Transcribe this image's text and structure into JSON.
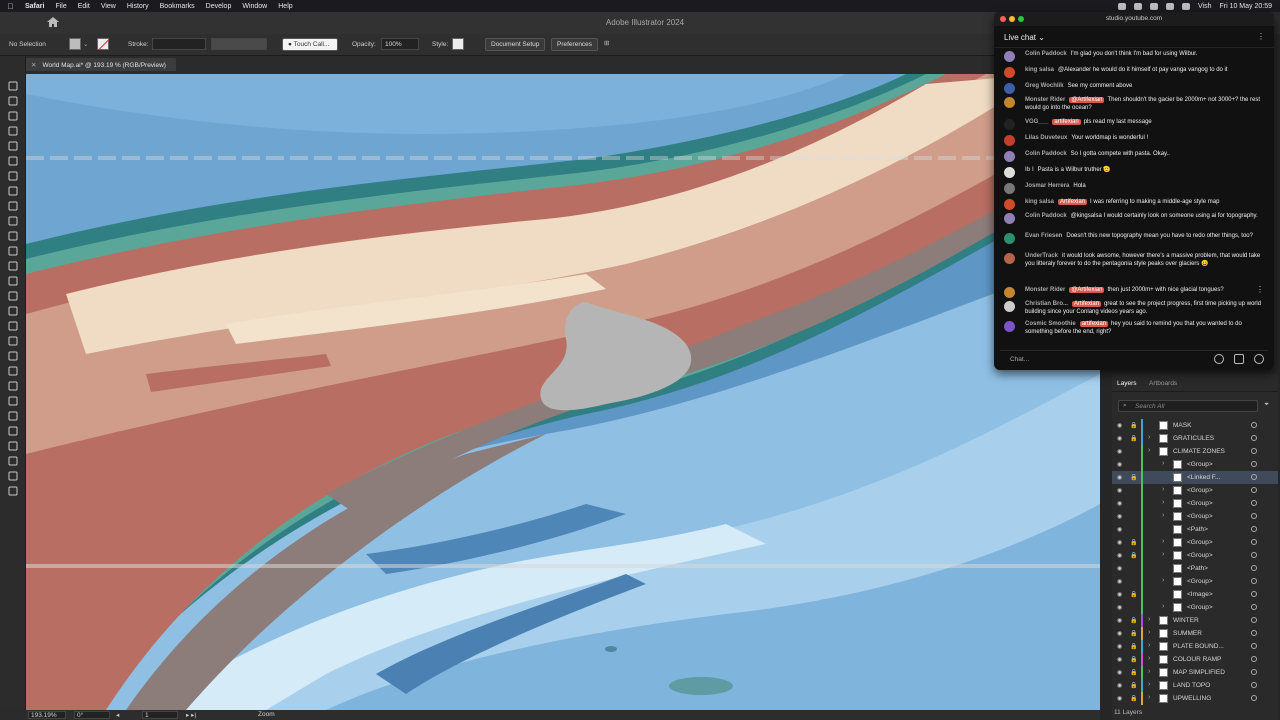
{
  "menubar": {
    "app": "Safari",
    "items": [
      "File",
      "Edit",
      "View",
      "History",
      "Bookmarks",
      "Develop",
      "Window",
      "Help"
    ],
    "user": "Vish",
    "datetime": "Fri 10 May  20:59"
  },
  "titlebar": {
    "title": "Adobe Illustrator 2024"
  },
  "controlbar": {
    "selection": "No Selection",
    "stroke_label": "Stroke:",
    "brush": "Touch Call...",
    "opacity_label": "Opacity:",
    "opacity_value": "100%",
    "style_label": "Style:",
    "document_setup": "Document Setup",
    "preferences": "Preferences"
  },
  "document_tab": {
    "name": "World Map.ai* @ 193.19 % (RGB/Preview)"
  },
  "statusbar": {
    "zoom": "193.19%",
    "rotation": "0°",
    "artboard": "1",
    "tool": "Zoom"
  },
  "chat": {
    "url": "studio.youtube.com",
    "header": "Live chat",
    "input_placeholder": "Chat...",
    "messages": [
      {
        "author": "Colin Paddock",
        "mention": "",
        "text": "I'm glad you don't think I'm bad for using Wilbur.",
        "avatar": "#8f7fb5"
      },
      {
        "author": "king salsa",
        "mention": "",
        "text": "@Alexander he would do it himself ot pay vanga vangog to do it",
        "avatar": "#d14b2b"
      },
      {
        "author": "Greg Wochlik",
        "mention": "",
        "text": "See my comment above",
        "avatar": "#3d5fa8"
      },
      {
        "author": "Monster Rider",
        "mention": "@Artifexian",
        "text": "Then shouldn't the gacier be 2000m+ not 3000+? the rest would go into the ocean?",
        "avatar": "#c4862e"
      },
      {
        "author": "VGG___",
        "mention": "artifexian",
        "text": "pls read my last message",
        "avatar": "#222222"
      },
      {
        "author": "Lilas Duveteux",
        "mention": "",
        "text": "Your worldmap is wonderful !",
        "avatar": "#c43d2e"
      },
      {
        "author": "Colin Paddock",
        "mention": "",
        "text": "So I gotta compete with pasta. Okay..",
        "avatar": "#8f7fb5"
      },
      {
        "author": "lb l",
        "mention": "",
        "text": "Pasta is a Wilbur truther 🫡",
        "avatar": "#dddddd"
      },
      {
        "author": "Josmar Herrera",
        "mention": "",
        "text": "Hola",
        "avatar": "#777777"
      },
      {
        "author": "king salsa",
        "mention": "Artifexian",
        "text": "I was referring to making a middle-age style map",
        "avatar": "#d14b2b"
      },
      {
        "author": "Colin Paddock",
        "mention": "",
        "text": "@kingsalsa I would certainly look on someone using ai for topography.",
        "avatar": "#8f7fb5"
      },
      {
        "author": "Evan Friesen",
        "mention": "",
        "text": "Doesn't this new topography mean you have to redo other things, too?",
        "avatar": "#2e8f6e"
      },
      {
        "author": "UnderTrack",
        "mention": "",
        "text": "it would look awsome, however there's a massive problem, that would take you litteraly forever to do the pentagonia style peaks over glaciers 😀",
        "avatar": "#b5654a"
      },
      {
        "author": "Monster Rider",
        "mention": "@Artifexian",
        "text": "then just 2000m+ with nice glacial tongues?",
        "avatar": "#c4862e"
      },
      {
        "author": "Christian Bro...",
        "mention": "Artifexian",
        "text": "great to see the project progress, first time picking up world building since your Conlang videos years ago.",
        "avatar": "#cccccc"
      },
      {
        "author": "Cosmic Smoothie",
        "mention": "artifexian",
        "text": "hey  you said to remind you that you wanted to do something before the end, right?",
        "avatar": "#7b54c9"
      }
    ]
  },
  "layers": {
    "tab_active": "Layers",
    "tab_other": "Artboards",
    "search_placeholder": "Search All",
    "count": "11 Layers",
    "rows": [
      {
        "name": "MASK",
        "level": 0,
        "color": "#45a3d6",
        "chev": false,
        "lock": true
      },
      {
        "name": "GRATICULES",
        "level": 0,
        "color": "#45a3d6",
        "chev": true,
        "lock": true
      },
      {
        "name": "CLIMATE ZONES",
        "level": 0,
        "color": "#4cbf6b",
        "chev": true,
        "lock": false
      },
      {
        "name": "<Group>",
        "level": 1,
        "color": "#4cbf6b",
        "chev": true,
        "lock": false
      },
      {
        "name": "<Linked F...",
        "level": 1,
        "color": "#4cbf6b",
        "chev": false,
        "lock": true,
        "selected": true
      },
      {
        "name": "<Group>",
        "level": 1,
        "color": "#4cbf6b",
        "chev": true,
        "lock": false
      },
      {
        "name": "<Group>",
        "level": 1,
        "color": "#4cbf6b",
        "chev": true,
        "lock": false
      },
      {
        "name": "<Group>",
        "level": 1,
        "color": "#4cbf6b",
        "chev": true,
        "lock": false
      },
      {
        "name": "<Path>",
        "level": 1,
        "color": "#4cbf6b",
        "chev": false,
        "lock": false
      },
      {
        "name": "<Group>",
        "level": 1,
        "color": "#4cbf6b",
        "chev": true,
        "lock": true
      },
      {
        "name": "<Group>",
        "level": 1,
        "color": "#4cbf6b",
        "chev": true,
        "lock": true
      },
      {
        "name": "<Path>",
        "level": 1,
        "color": "#4cbf6b",
        "chev": false,
        "lock": false
      },
      {
        "name": "<Group>",
        "level": 1,
        "color": "#4cbf6b",
        "chev": true,
        "lock": false
      },
      {
        "name": "<Image>",
        "level": 1,
        "color": "#4cbf6b",
        "chev": false,
        "lock": true
      },
      {
        "name": "<Group>",
        "level": 1,
        "color": "#4cbf6b",
        "chev": true,
        "lock": false
      },
      {
        "name": "WINTER",
        "level": 0,
        "color": "#9b59d6",
        "chev": true,
        "lock": true
      },
      {
        "name": "SUMMER",
        "level": 0,
        "color": "#d9a83b",
        "chev": true,
        "lock": true
      },
      {
        "name": "PLATE BOUND...",
        "level": 0,
        "color": "#45a3d6",
        "chev": true,
        "lock": true
      },
      {
        "name": "COLOUR RAMP",
        "level": 0,
        "color": "#d64fd0",
        "chev": true,
        "lock": true
      },
      {
        "name": "MAP SIMPLIFIED",
        "level": 0,
        "color": "#4cbf6b",
        "chev": true,
        "lock": true
      },
      {
        "name": "LAND TOPO",
        "level": 0,
        "color": "#45a3d6",
        "chev": true,
        "lock": true
      },
      {
        "name": "UPWELLING",
        "level": 0,
        "color": "#d9a83b",
        "chev": true,
        "lock": true
      }
    ]
  },
  "colors": {
    "deep_ocean": "#5e96c6",
    "shelf": "#8fc0e4",
    "lowland": "#b86e62",
    "midland": "#cf9d8a",
    "highland": "#f0dcc4",
    "gray_band": "#8c7c7a",
    "coast": "#2f7f83",
    "glacier": "#b5b5b5",
    "mention": "#d8584a"
  }
}
